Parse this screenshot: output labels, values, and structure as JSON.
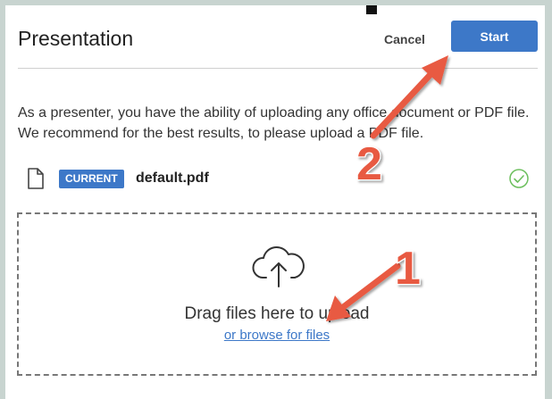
{
  "header": {
    "title": "Presentation",
    "cancel_label": "Cancel",
    "start_label": "Start"
  },
  "description": "As a presenter, you have the ability of uploading any office document or PDF file. We recommend for the best results, to please upload a PDF file.",
  "file": {
    "badge": "CURRENT",
    "name": "default.pdf"
  },
  "dropzone": {
    "drag_text": "Drag files here to upload",
    "browse_link": "or browse for files"
  },
  "annotations": {
    "step_1": "1",
    "step_2": "2"
  },
  "icons": [
    "file-icon",
    "check-circle-icon",
    "cloud-upload-icon"
  ],
  "colors": {
    "accent": "#3d78c8",
    "annotation": "#e85a43",
    "check": "#6cbf5d"
  }
}
